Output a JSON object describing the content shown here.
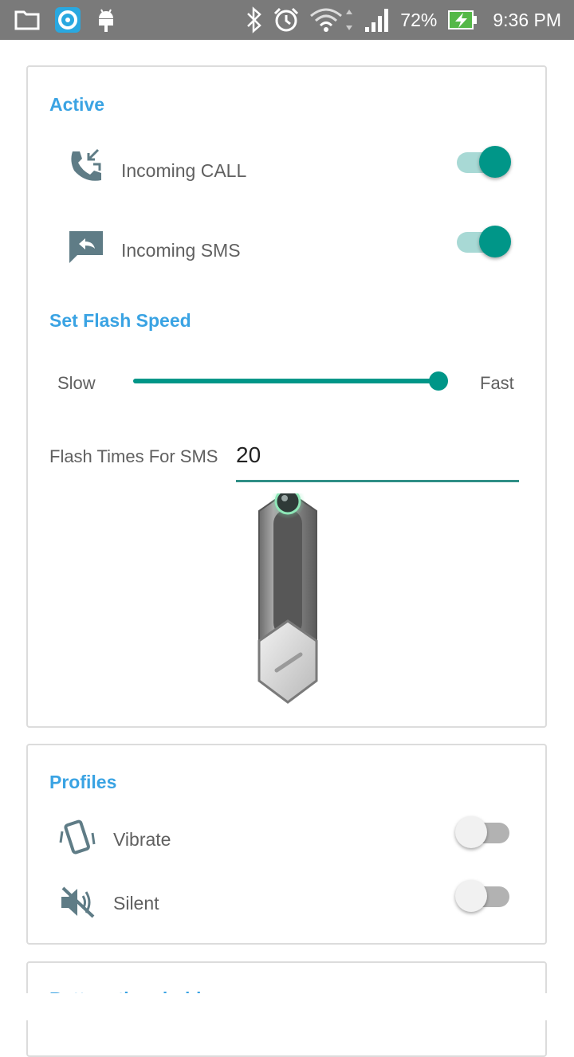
{
  "status_bar": {
    "battery": "72%",
    "time": "9:36 PM",
    "icons": [
      "folder-icon",
      "app-icon",
      "android-icon",
      "bluetooth-icon",
      "alarm-icon",
      "wifi-icon",
      "signal-icon",
      "battery-charging-icon"
    ]
  },
  "active": {
    "title": "Active",
    "incoming_call": {
      "label": "Incoming CALL",
      "enabled": true
    },
    "incoming_sms": {
      "label": "Incoming SMS",
      "enabled": true
    }
  },
  "flash_speed": {
    "title": "Set Flash Speed",
    "slow_label": "Slow",
    "fast_label": "Fast",
    "value": 1.0
  },
  "flash_times": {
    "label": "Flash Times For SMS",
    "value": "20"
  },
  "profiles": {
    "title": "Profiles",
    "vibrate": {
      "label": "Vibrate",
      "enabled": false
    },
    "silent": {
      "label": "Silent",
      "enabled": false
    }
  },
  "next_section": {
    "title": "Battery threshold"
  },
  "colors": {
    "accent": "#009688",
    "title_blue": "#3aa3e3",
    "status_bar": "#7a7a7a"
  }
}
